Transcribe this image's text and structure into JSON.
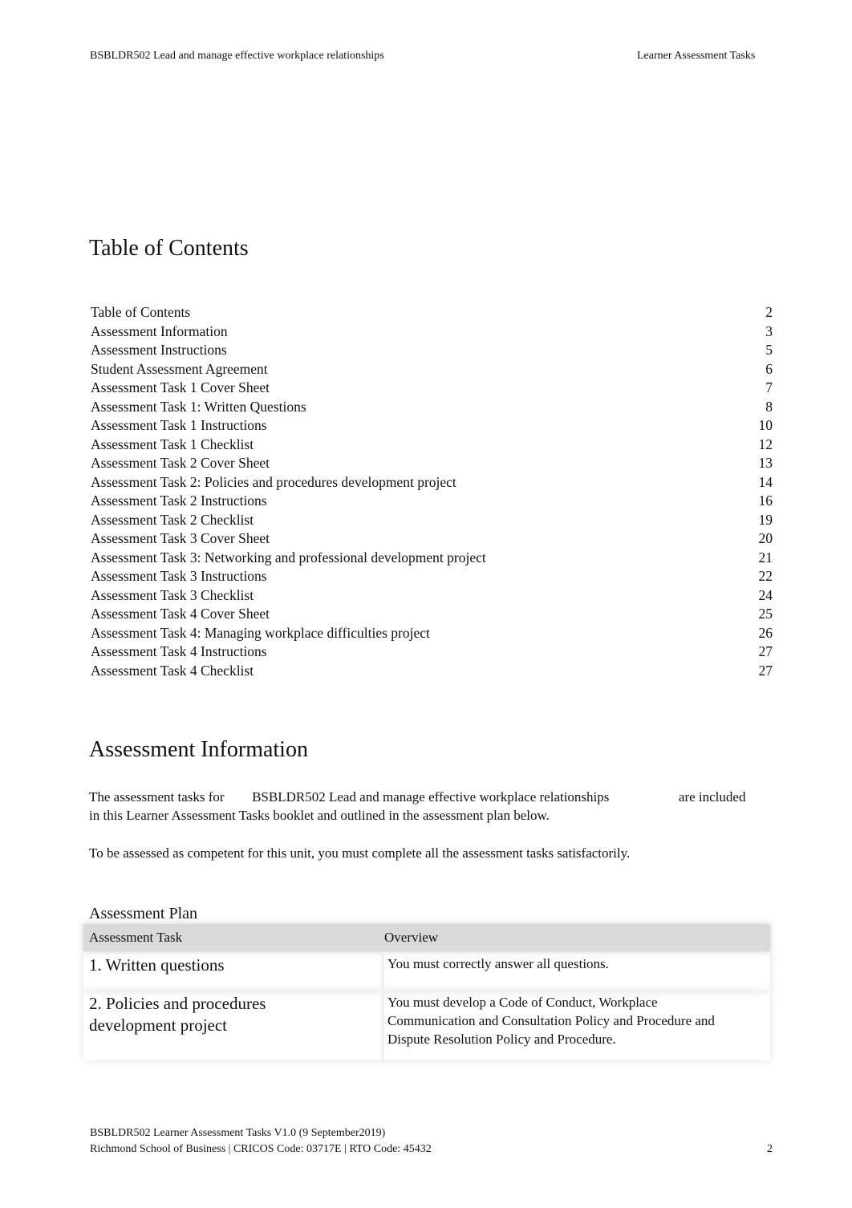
{
  "header": {
    "left": "BSBLDR502 Lead and manage effective workplace relationships",
    "right": "Learner Assessment Tasks"
  },
  "toc": {
    "title": "Table of Contents",
    "entries": [
      {
        "label": "Table of Contents",
        "page": "2"
      },
      {
        "label": "Assessment Information",
        "page": "3"
      },
      {
        "label": "Assessment Instructions",
        "page": "5"
      },
      {
        "label": "Student Assessment Agreement",
        "page": "6"
      },
      {
        "label": "Assessment Task 1 Cover Sheet",
        "page": "7"
      },
      {
        "label": "Assessment Task 1: Written Questions",
        "page": "8"
      },
      {
        "label": "Assessment Task 1 Instructions",
        "page": "10"
      },
      {
        "label": "Assessment Task 1 Checklist",
        "page": "12"
      },
      {
        "label": "Assessment Task 2 Cover Sheet",
        "page": "13"
      },
      {
        "label": "Assessment Task 2: Policies and procedures development project",
        "page": "14"
      },
      {
        "label": "Assessment Task 2 Instructions",
        "page": "16"
      },
      {
        "label": "Assessment Task 2 Checklist",
        "page": "19"
      },
      {
        "label": "Assessment Task 3 Cover Sheet",
        "page": "20"
      },
      {
        "label": "Assessment Task 3: Networking and professional development project",
        "page": "21"
      },
      {
        "label": "Assessment Task 3 Instructions",
        "page": "22"
      },
      {
        "label": "Assessment Task 3 Checklist",
        "page": "24"
      },
      {
        "label": "Assessment Task 4 Cover Sheet",
        "page": "25"
      },
      {
        "label": "Assessment Task 4: Managing workplace difficulties project",
        "page": "26"
      },
      {
        "label": "Assessment Task 4 Instructions",
        "page": "27"
      },
      {
        "label": "Assessment Task 4 Checklist",
        "page": "27"
      }
    ]
  },
  "info": {
    "title": "Assessment Information",
    "para1_a": "The assessment tasks for",
    "para1_b": "BSBLDR502 Lead and manage effective workplace relationships",
    "para1_c": "are included",
    "para1_d": "in this Learner Assessment Tasks booklet and outlined in the assessment plan below.",
    "para2": "To be assessed as competent for this unit, you must complete all the assessment tasks satisfactorily."
  },
  "plan": {
    "title": "Assessment Plan",
    "headers": [
      "Assessment Task",
      "Overview"
    ],
    "rows": [
      {
        "task": "1. Written questions",
        "overview": "You must correctly answer all questions."
      },
      {
        "task": "2. Policies and procedures development project",
        "overview": "You must develop a Code of Conduct, Workplace Communication and Consultation Policy and Procedure and Dispute Resolution Policy and Procedure."
      }
    ]
  },
  "footer": {
    "line1": "BSBLDR502 Learner Assessment Tasks V1.0 (9 September2019)",
    "line2": "Richmond School of Business | CRICOS Code: 03717E | RTO Code: 45432",
    "page": "2"
  }
}
